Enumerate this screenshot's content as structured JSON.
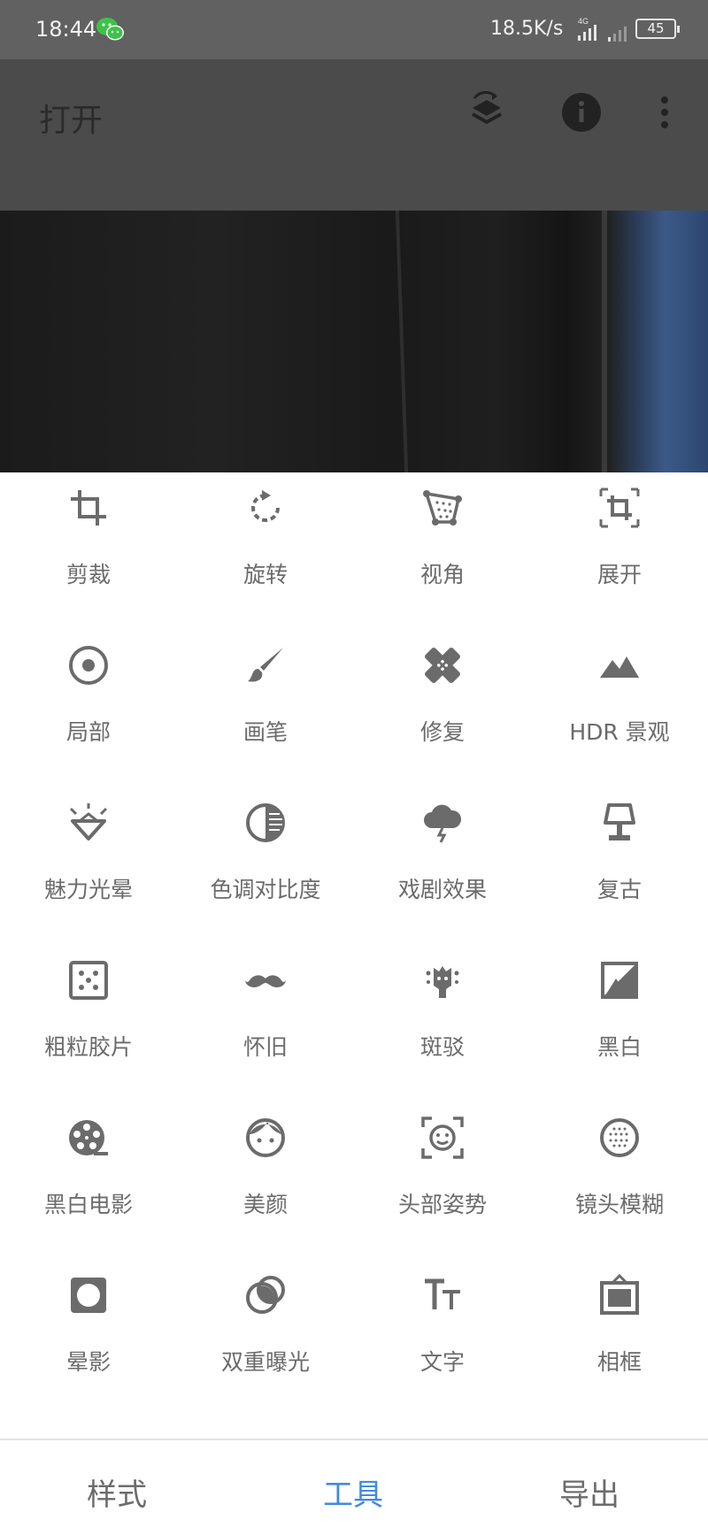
{
  "status_bar": {
    "time": "18:44",
    "speed": "18.5K/s",
    "network": "4G",
    "battery": "45"
  },
  "app_bar": {
    "title": "打开",
    "actions": [
      "layers-stack-icon",
      "info-icon",
      "more-vert-icon"
    ]
  },
  "tools": [
    {
      "label": "剪裁",
      "icon": "crop-icon"
    },
    {
      "label": "旋转",
      "icon": "rotate-icon"
    },
    {
      "label": "视角",
      "icon": "perspective-icon"
    },
    {
      "label": "展开",
      "icon": "expand-icon"
    },
    {
      "label": "局部",
      "icon": "selective-icon"
    },
    {
      "label": "画笔",
      "icon": "brush-icon"
    },
    {
      "label": "修复",
      "icon": "healing-icon"
    },
    {
      "label": "HDR 景观",
      "icon": "mountains-icon"
    },
    {
      "label": "魅力光晕",
      "icon": "glamour-glow-icon"
    },
    {
      "label": "色调对比度",
      "icon": "tonal-contrast-icon"
    },
    {
      "label": "戏剧效果",
      "icon": "drama-cloud-icon"
    },
    {
      "label": "复古",
      "icon": "vintage-lamp-icon"
    },
    {
      "label": "粗粒胶片",
      "icon": "grainy-film-icon"
    },
    {
      "label": "怀旧",
      "icon": "mustache-icon"
    },
    {
      "label": "斑驳",
      "icon": "grunge-icon"
    },
    {
      "label": "黑白",
      "icon": "black-white-icon"
    },
    {
      "label": "黑白电影",
      "icon": "film-reel-icon"
    },
    {
      "label": "美颜",
      "icon": "face-icon"
    },
    {
      "label": "头部姿势",
      "icon": "head-pose-icon"
    },
    {
      "label": "镜头模糊",
      "icon": "lens-blur-icon"
    },
    {
      "label": "晕影",
      "icon": "vignette-icon"
    },
    {
      "label": "双重曝光",
      "icon": "double-exposure-icon"
    },
    {
      "label": "文字",
      "icon": "text-icon"
    },
    {
      "label": "相框",
      "icon": "frame-icon"
    }
  ],
  "bottom_nav": {
    "items": [
      "样式",
      "工具",
      "导出"
    ],
    "active": "工具"
  },
  "colors": {
    "accent": "#3f8be0",
    "icon": "#6b6b6b",
    "label": "#6b6b6b"
  }
}
